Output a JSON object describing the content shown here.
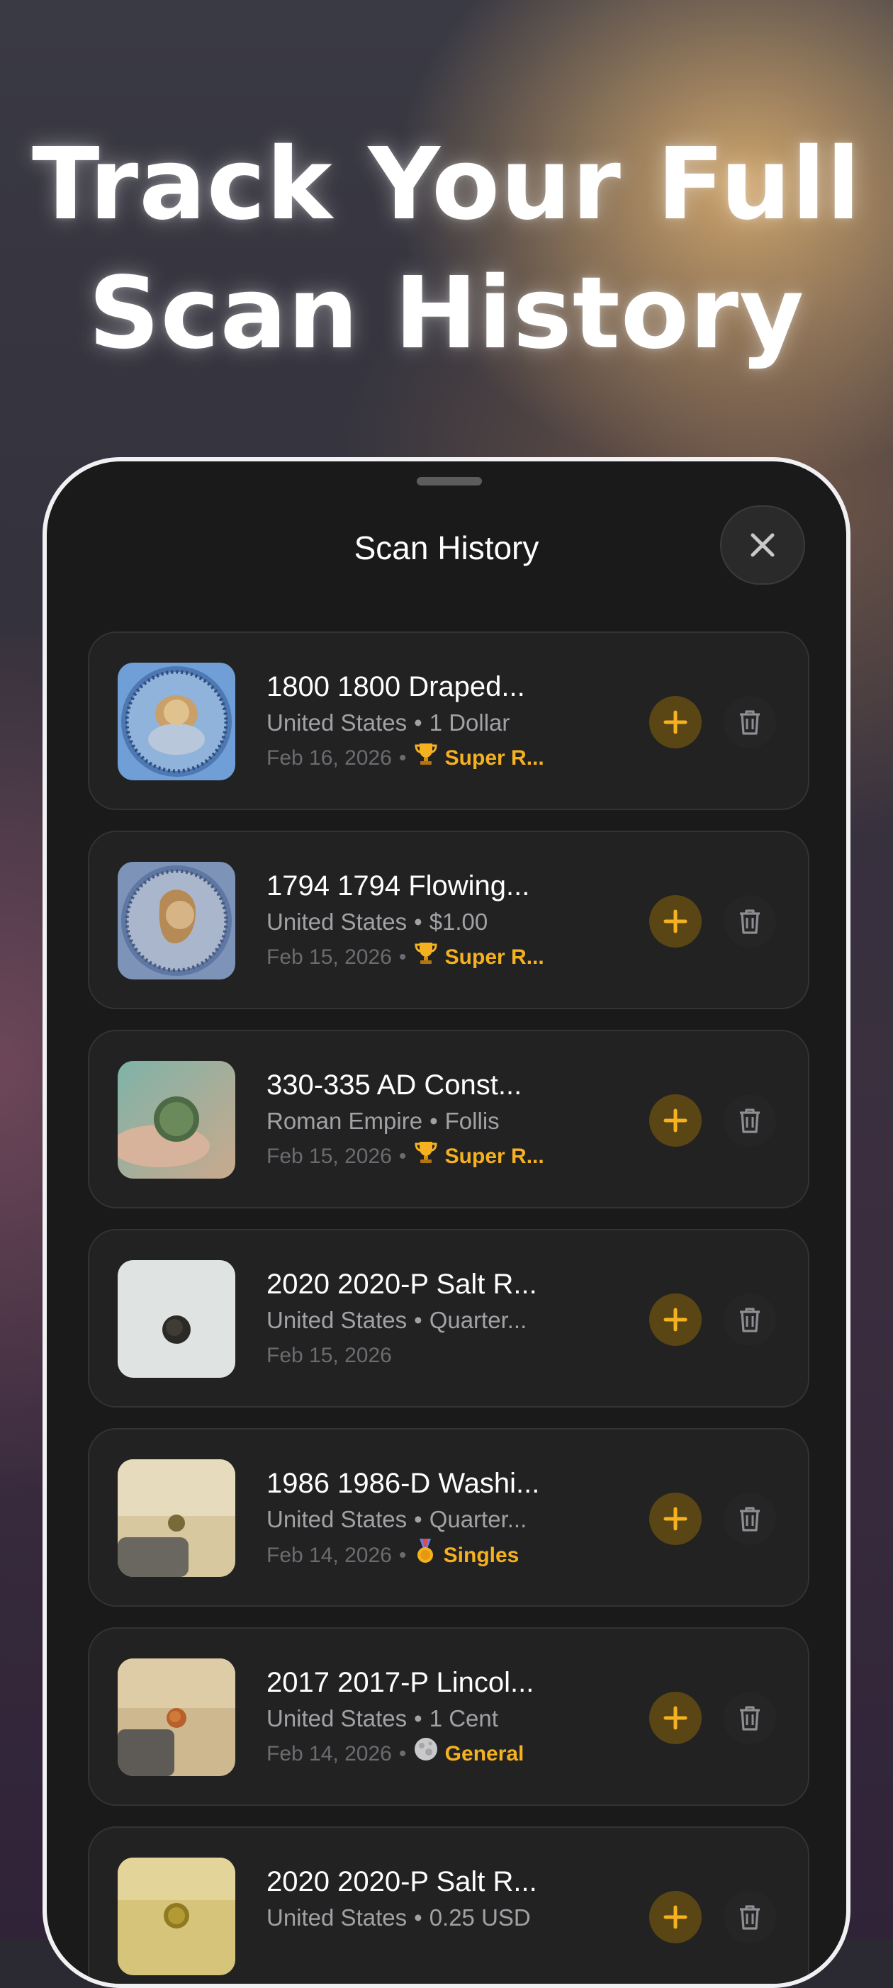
{
  "headline": {
    "line1": "Track Your Full",
    "line2": "Scan History"
  },
  "sheet": {
    "title": "Scan History",
    "close_icon": "close-icon"
  },
  "colors": {
    "accent": "#f5b11f",
    "card_bg": "#222223",
    "sheet_bg": "#1a1a1a"
  },
  "items": [
    {
      "name": "1800 1800 Draped...",
      "country": "United States",
      "denomination": "1 Dollar",
      "date": "Feb 16, 2026",
      "tag": "Super R...",
      "tag_icon": "trophy-icon"
    },
    {
      "name": "1794 1794 Flowing...",
      "country": "United States",
      "denomination": "$1.00",
      "date": "Feb 15, 2026",
      "tag": "Super R...",
      "tag_icon": "trophy-icon"
    },
    {
      "name": "330-335 AD Const...",
      "country": "Roman Empire",
      "denomination": "Follis",
      "date": "Feb 15, 2026",
      "tag": "Super R...",
      "tag_icon": "trophy-icon"
    },
    {
      "name": "2020 2020-P Salt R...",
      "country": "United States",
      "denomination": "Quarter...",
      "date": "Feb 15, 2026",
      "tag": "",
      "tag_icon": ""
    },
    {
      "name": "1986 1986-D Washi...",
      "country": "United States",
      "denomination": "Quarter...",
      "date": "Feb 14, 2026",
      "tag": "Singles",
      "tag_icon": "medal-icon"
    },
    {
      "name": "2017 2017-P Lincol...",
      "country": "United States",
      "denomination": "1 Cent",
      "date": "Feb 14, 2026",
      "tag": "General",
      "tag_icon": "moon-icon"
    },
    {
      "name": "2020 2020-P Salt R...",
      "country": "United States",
      "denomination": "0.25 USD",
      "date": "",
      "tag": "",
      "tag_icon": ""
    }
  ],
  "separator": "•"
}
